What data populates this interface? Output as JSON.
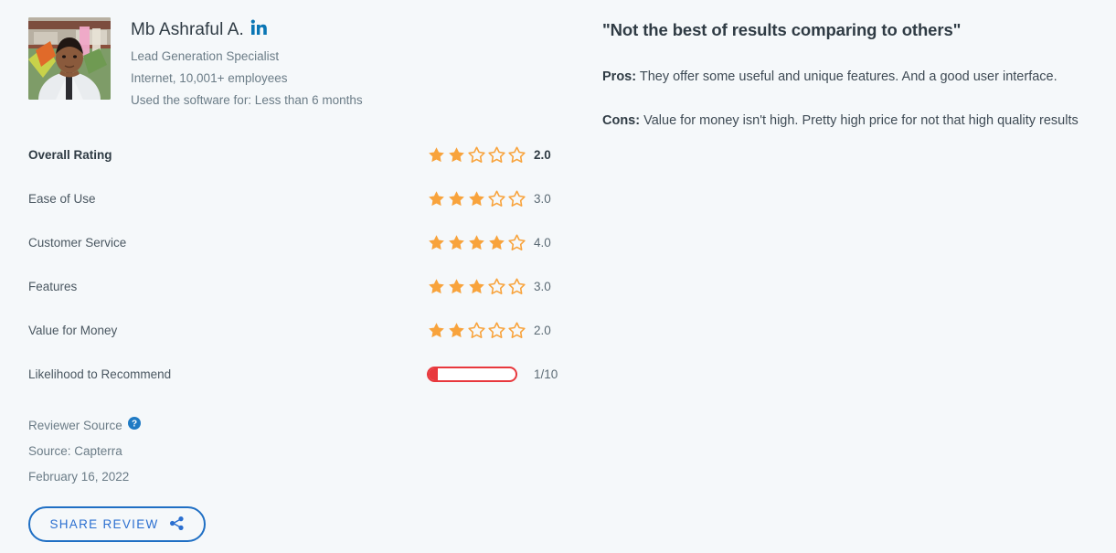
{
  "reviewer": {
    "name": "Mb Ashraful A.",
    "linkedin_icon": "linkedin-icon",
    "job_title": "Lead Generation Specialist",
    "industry_size": "Internet, 10,001+ employees",
    "usage_duration": "Used the software for: Less than 6 months"
  },
  "ratings": [
    {
      "label": "Overall Rating",
      "value": "2.0",
      "stars": 2,
      "max": 5
    },
    {
      "label": "Ease of Use",
      "value": "3.0",
      "stars": 3,
      "max": 5
    },
    {
      "label": "Customer Service",
      "value": "4.0",
      "stars": 4,
      "max": 5
    },
    {
      "label": "Features",
      "value": "3.0",
      "stars": 3,
      "max": 5
    },
    {
      "label": "Value for Money",
      "value": "2.0",
      "stars": 2,
      "max": 5
    }
  ],
  "likelihood": {
    "label": "Likelihood to Recommend",
    "value": "1/10",
    "score": 1,
    "max": 10,
    "bar_color": "#e8383d"
  },
  "source": {
    "reviewer_source_label": "Reviewer Source",
    "help_icon": "help-circle-icon",
    "source_line": "Source: Capterra",
    "date": "February 16, 2022"
  },
  "share": {
    "label": "SHARE REVIEW",
    "icon": "share-icon"
  },
  "review": {
    "title": "\"Not the best of results comparing to others\"",
    "pros_label": "Pros:",
    "pros_text": " They offer some useful and unique features. And a good user interface.",
    "cons_label": "Cons:",
    "cons_text": " Value for money isn't high. Pretty high price for not that high quality results"
  },
  "colors": {
    "page_background": "#f5f8fa",
    "star_filled": "#f8a33c",
    "star_empty_stroke": "#f8a33c",
    "link_blue": "#2b6fd0",
    "linkedin_blue": "#0a76b5",
    "red": "#e8383d",
    "text_dark": "#2f3b44",
    "text_muted": "#6b7c87"
  }
}
